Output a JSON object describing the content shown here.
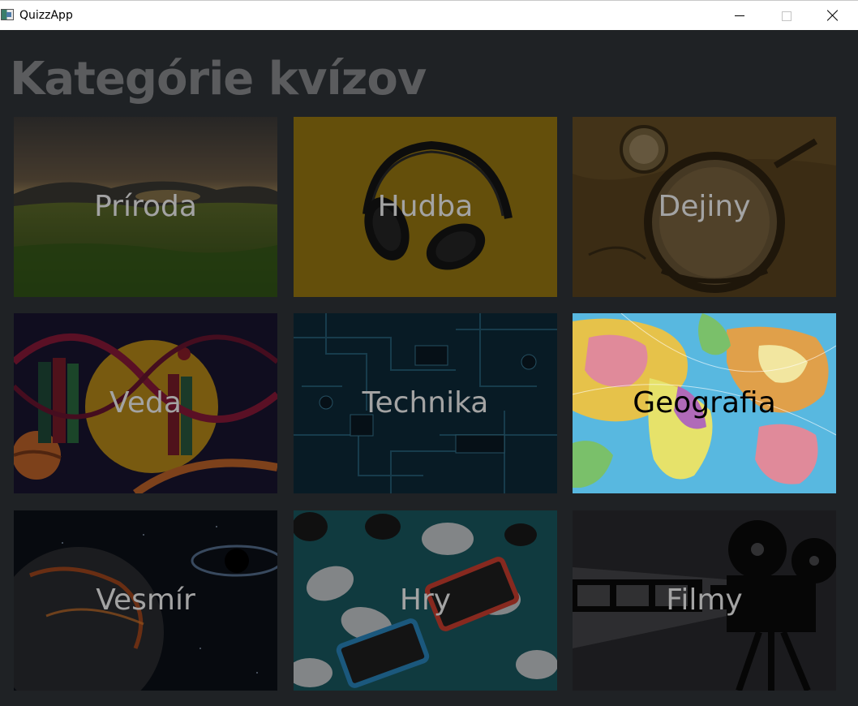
{
  "window": {
    "title": "QuizzApp",
    "icon": "app-icon",
    "controls": [
      "minimize-icon",
      "maximize-icon",
      "close-icon"
    ]
  },
  "page": {
    "title": "Kategórie kvízov"
  },
  "categories": [
    {
      "label": "Príroda",
      "image": "meadow-sunset"
    },
    {
      "label": "Hudba",
      "image": "headphones"
    },
    {
      "label": "Dejiny",
      "image": "compass-old-map"
    },
    {
      "label": "Veda",
      "image": "dna-books-planets"
    },
    {
      "label": "Technika",
      "image": "circuit-board"
    },
    {
      "label": "Geografia",
      "image": "world-globe-map"
    },
    {
      "label": "Vesmír",
      "image": "planet-black-hole"
    },
    {
      "label": "Hry",
      "image": "game-controllers"
    },
    {
      "label": "Filmy",
      "image": "film-projector"
    }
  ],
  "colors": {
    "background": "#1f2225",
    "title_text": "#5b5c5e",
    "tile_label": "#a3a3a3",
    "tile_label_light": "#000000"
  }
}
